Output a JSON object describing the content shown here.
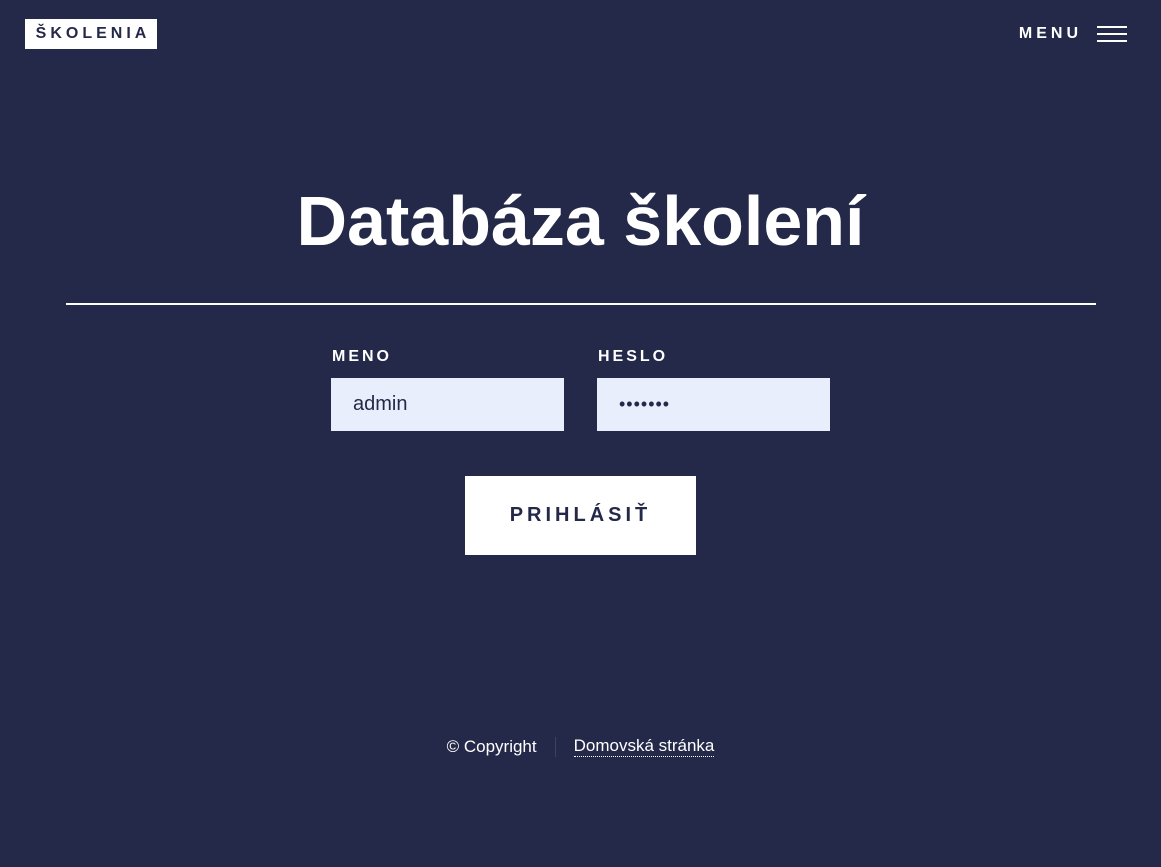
{
  "header": {
    "logo": "ŠKOLENIA",
    "menu_label": "MENU"
  },
  "main": {
    "title": "Databáza školení",
    "form": {
      "username_label": "MENO",
      "username_value": "admin",
      "password_label": "HESLO",
      "password_value": "•••••••",
      "submit_label": "PRIHLÁSIŤ"
    }
  },
  "footer": {
    "copyright": "© Copyright",
    "home_link": "Domovská stránka"
  },
  "colors": {
    "background": "#242949",
    "input_background": "#e8eefb",
    "text": "#ffffff"
  }
}
